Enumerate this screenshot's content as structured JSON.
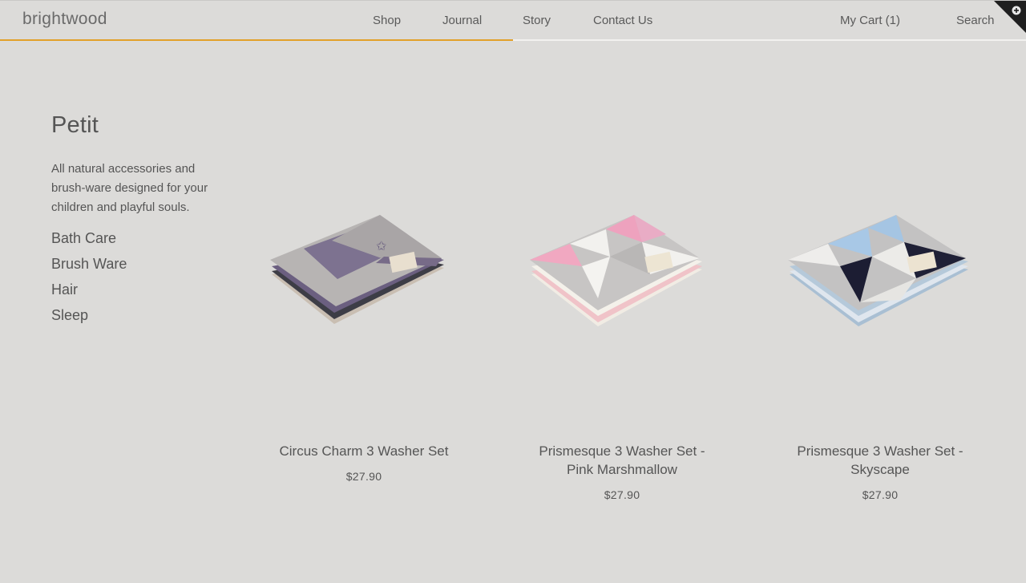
{
  "brand": {
    "logo_text": "brightwood",
    "accent": "#e2a02a"
  },
  "nav": {
    "shop": "Shop",
    "journal": "Journal",
    "story": "Story",
    "contact": "Contact Us",
    "cart": "My Cart (1)",
    "search": "Search"
  },
  "scroll_progress": 0.5,
  "sidebar": {
    "title": "Petit",
    "description": "All natural accessories and brush-ware designed for your children and playful souls.",
    "categories": [
      {
        "label": "Bath Care"
      },
      {
        "label": "Brush Ware"
      },
      {
        "label": "Hair"
      },
      {
        "label": "Sleep"
      }
    ]
  },
  "products": [
    {
      "name": "Circus Charm 3 Washer Set",
      "price": "$27.90",
      "image": "folded-washcloth-grey-purple"
    },
    {
      "name": "Prismesque 3 Washer Set - Pink Marshmallow",
      "price": "$27.90",
      "image": "folded-washcloth-pink-triangles"
    },
    {
      "name": "Prismesque 3 Washer Set - Skyscape",
      "price": "$27.90",
      "image": "folded-washcloth-blue-triangles"
    }
  ],
  "colors": {
    "background": "#dcdbd9",
    "text": "#555555"
  }
}
